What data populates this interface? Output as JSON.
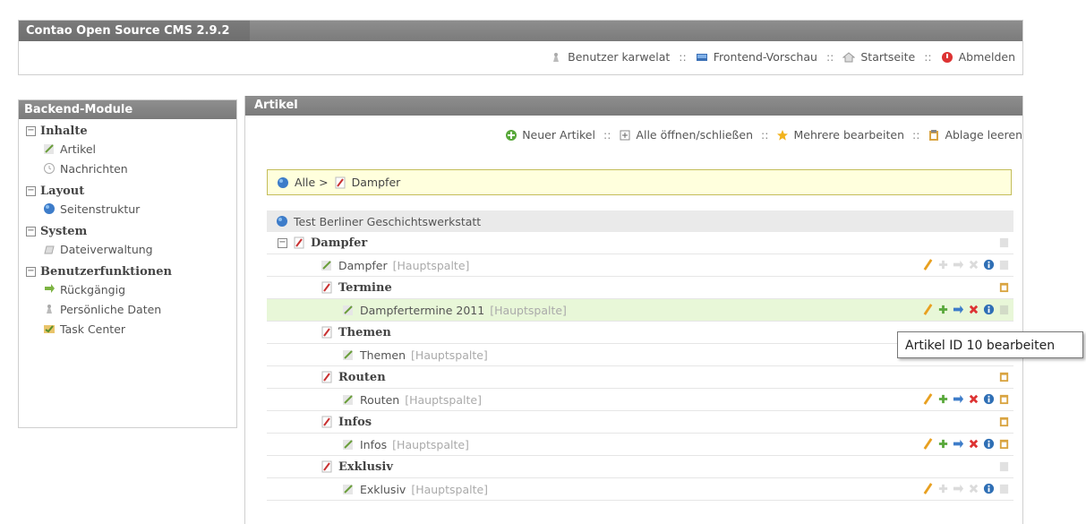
{
  "app": {
    "title": "Contao Open Source CMS 2.9.2"
  },
  "topnav": {
    "user_label": "Benutzer karwelat",
    "preview_label": "Frontend-Vorschau",
    "home_label": "Startseite",
    "logout_label": "Abmelden",
    "sep": "::"
  },
  "sidebar": {
    "title": "Backend-Module",
    "groups": [
      {
        "label": "Inhalte",
        "items": [
          {
            "label": "Artikel",
            "icon": "article-icon"
          },
          {
            "label": "Nachrichten",
            "icon": "clock-icon"
          }
        ]
      },
      {
        "label": "Layout",
        "items": [
          {
            "label": "Seitenstruktur",
            "icon": "globe-icon"
          }
        ]
      },
      {
        "label": "System",
        "items": [
          {
            "label": "Dateiverwaltung",
            "icon": "files-icon"
          }
        ]
      },
      {
        "label": "Benutzerfunktionen",
        "items": [
          {
            "label": "Rückgängig",
            "icon": "undo-arrow-icon"
          },
          {
            "label": "Persönliche Daten",
            "icon": "user-icon"
          },
          {
            "label": "Task Center",
            "icon": "task-icon"
          }
        ]
      }
    ]
  },
  "main": {
    "title": "Artikel",
    "actions": {
      "new_label": "Neuer Artikel",
      "toggle_label": "Alle öffnen/schließen",
      "multi_label": "Mehrere bearbeiten",
      "clipboard_label": "Ablage leeren"
    },
    "breadcrumb": {
      "all": "Alle >",
      "current": "Dampfer"
    },
    "tree": {
      "root": "Test Berliner Geschichtswerkstatt",
      "rows": [
        {
          "type": "page",
          "label": "Dampfer",
          "expanded": true
        },
        {
          "type": "article",
          "label": "Dampfer",
          "column": "[Hauptspalte]"
        },
        {
          "type": "page",
          "label": "Termine"
        },
        {
          "type": "article",
          "label": "Dampfertermine 2011",
          "column": "[Hauptspalte]",
          "highlight": true
        },
        {
          "type": "page",
          "label": "Themen"
        },
        {
          "type": "article",
          "label": "Themen",
          "column": "[Hauptspalte]"
        },
        {
          "type": "page",
          "label": "Routen"
        },
        {
          "type": "article",
          "label": "Routen",
          "column": "[Hauptspalte]"
        },
        {
          "type": "page",
          "label": "Infos"
        },
        {
          "type": "article",
          "label": "Infos",
          "column": "[Hauptspalte]"
        },
        {
          "type": "page",
          "label": "Exklusiv"
        },
        {
          "type": "article",
          "label": "Exklusiv",
          "column": "[Hauptspalte]"
        }
      ]
    }
  },
  "tooltip": {
    "text": "Artikel ID 10 bearbeiten"
  },
  "colors": {
    "header": "#848484",
    "highlight_row": "#e8f7d8",
    "breadcrumb_bg": "#ffffdd",
    "breadcrumb_border": "#c4bd5a"
  }
}
